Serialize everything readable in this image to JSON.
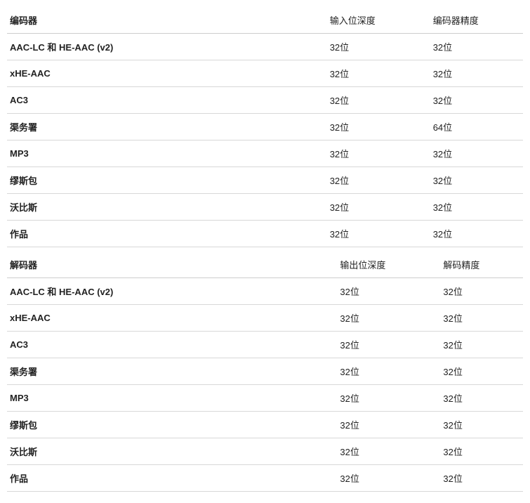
{
  "table1": {
    "headers": {
      "c1": "编码器",
      "c2": "输入位深度",
      "c3": "编码器精度"
    },
    "rows": [
      {
        "c1": "AAC-LC 和 HE-AAC (v2)",
        "c2": "32位",
        "c3": "32位"
      },
      {
        "c1": "xHE-AAC",
        "c2": "32位",
        "c3": "32位"
      },
      {
        "c1": "AC3",
        "c2": "32位",
        "c3": "32位"
      },
      {
        "c1": "渠务署",
        "c2": "32位",
        "c3": "64位"
      },
      {
        "c1": "MP3",
        "c2": "32位",
        "c3": "32位"
      },
      {
        "c1": "缪斯包",
        "c2": "32位",
        "c3": "32位"
      },
      {
        "c1": "沃比斯",
        "c2": "32位",
        "c3": "32位"
      },
      {
        "c1": "作品",
        "c2": "32位",
        "c3": "32位"
      }
    ]
  },
  "table2": {
    "headers": {
      "c1": "解码器",
      "c2": "输出位深度",
      "c3": "解码精度"
    },
    "rows": [
      {
        "c1": "AAC-LC 和 HE-AAC (v2)",
        "c2": "32位",
        "c3": "32位"
      },
      {
        "c1": "xHE-AAC",
        "c2": "32位",
        "c3": "32位"
      },
      {
        "c1": "AC3",
        "c2": "32位",
        "c3": "32位"
      },
      {
        "c1": "渠务署",
        "c2": "32位",
        "c3": "32位"
      },
      {
        "c1": "MP3",
        "c2": "32位",
        "c3": "32位"
      },
      {
        "c1": "缪斯包",
        "c2": "32位",
        "c3": "32位"
      },
      {
        "c1": "沃比斯",
        "c2": "32位",
        "c3": "32位"
      },
      {
        "c1": "作品",
        "c2": "32位",
        "c3": "32位"
      }
    ]
  }
}
